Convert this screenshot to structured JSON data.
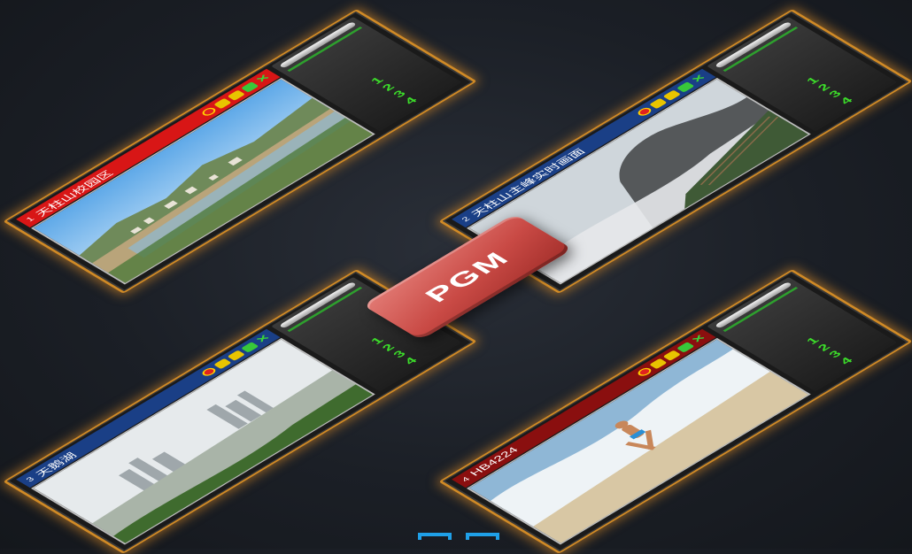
{
  "monitors": [
    {
      "number": "1",
      "title": "天柱山校园区",
      "title_color": "#d81616",
      "keys": [
        "1",
        "2",
        "3",
        "4"
      ]
    },
    {
      "number": "2",
      "title": "天柱山主峰实时画面",
      "title_color": "#1a3f86",
      "keys": [
        "1",
        "2",
        "3",
        "4"
      ]
    },
    {
      "number": "3",
      "title": "天鹅湖",
      "title_color": "#1a3f86",
      "keys": [
        "1",
        "2",
        "3",
        "4"
      ]
    },
    {
      "number": "4",
      "title": "HB4224",
      "title_color": "#8a0f0f",
      "keys": [
        "1",
        "2",
        "3",
        "4"
      ]
    }
  ],
  "pgm_button": {
    "label": "PGM",
    "color": "#c94a45"
  },
  "accent": "#d08a26"
}
